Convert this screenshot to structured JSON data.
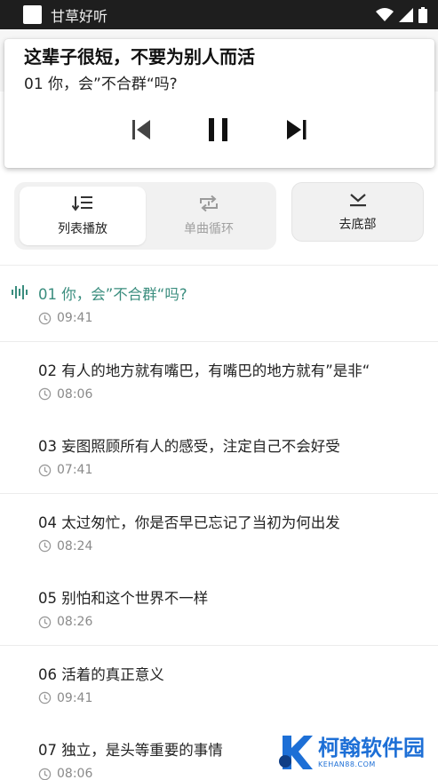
{
  "status_bar": {
    "app_title": "甘草好听",
    "icons": [
      "wifi-icon",
      "signal-icon",
      "battery-icon"
    ]
  },
  "notification": {
    "title": "这辈子很短，不要为别人而活",
    "subtitle": "01 你，会”不合群“吗?",
    "controls": [
      "skip-previous-icon",
      "pause-icon",
      "skip-next-icon"
    ]
  },
  "modes": {
    "list_play": "列表播放",
    "single_loop": "单曲循环",
    "go_bottom": "去底部"
  },
  "tracks": [
    {
      "title": "01 你，会”不合群“吗?",
      "duration": "09:41",
      "playing": true
    },
    {
      "title": "02 有人的地方就有嘴巴，有嘴巴的地方就有”是非“",
      "duration": "08:06"
    },
    {
      "title": "03 妄图照顾所有人的感受，注定自己不会好受",
      "duration": "07:41"
    },
    {
      "title": "04 太过匆忙，你是否早已忘记了当初为何出发",
      "duration": "08:24"
    },
    {
      "title": "05 别怕和这个世界不一样",
      "duration": "08:26"
    },
    {
      "title": "06 活着的真正意义",
      "duration": "09:41"
    },
    {
      "title": "07 独立，是头等重要的事情",
      "duration": "08:06"
    }
  ],
  "watermark": {
    "text": "柯翰软件园",
    "domain": "KEHAN88.COM"
  },
  "colors": {
    "accent": "#3a8d7e",
    "status_bar": "#1e1e1e",
    "watermark": "#1d6fd6"
  }
}
